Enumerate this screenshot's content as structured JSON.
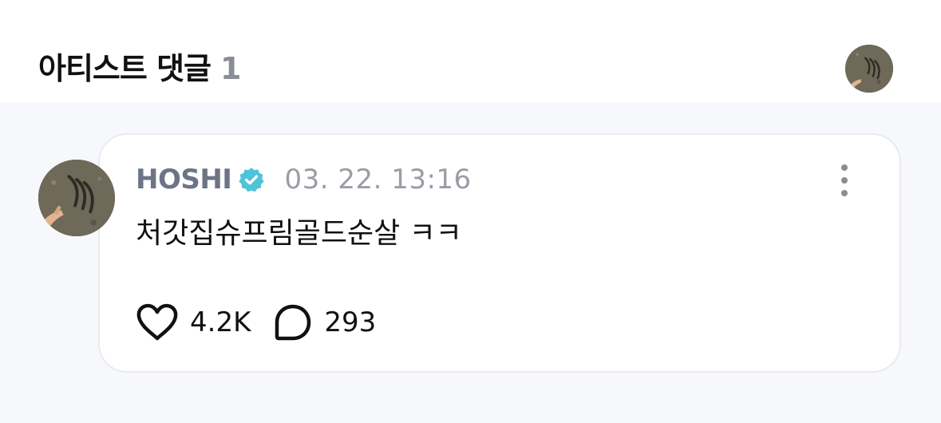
{
  "header": {
    "title": "아티스트 댓글",
    "count": "1",
    "avatar_icon": "profile-photo-icon"
  },
  "comment": {
    "author": "HOSHI",
    "verified_icon": "verified-badge-icon",
    "timestamp": "03. 22. 13:16",
    "text": "처갓집슈프림골드순살 ㅋㅋ",
    "more_icon": "more-vertical-icon",
    "likes": "4.2K",
    "like_icon": "heart-outline-icon",
    "replies": "293",
    "reply_icon": "chat-bubble-icon"
  },
  "colors": {
    "author": "#6c7486",
    "verified": "#4fc3d9",
    "background": "#f7f8fb",
    "card_border": "#e9ebf0"
  }
}
